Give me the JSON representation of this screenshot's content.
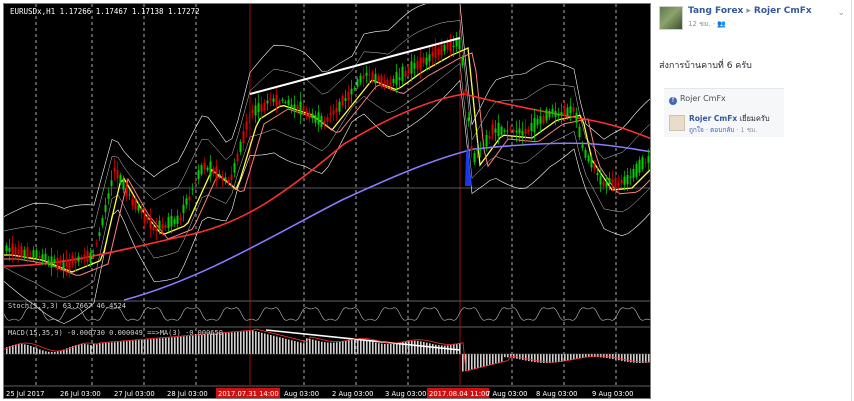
{
  "chart": {
    "symbol_info": "EURUSDx,H1  1.17266 1.17467 1.17138 1.17272",
    "stoch_label": "Stoch(5,3,3) 63.7667 46.4524",
    "macd_label": "MACD(15,35,9) -0.000730 0.000049 ==>MA(3) -0.000650",
    "x_labels": [
      "25 Jul 2017",
      "26 Jul 03:00",
      "27 Jul 03:00",
      "28 Jul 03:00",
      "2017.07.31 14:00",
      "Aug 03:00",
      "2 Aug 03:00",
      "3 Aug 03:00",
      "2017.08.04 11:00",
      "7 Aug 03:00",
      "8 Aug 03:00",
      "9 Aug 03:00"
    ],
    "colors": {
      "background": "#000000",
      "bull_candle": "#00d000",
      "bear_candle": "#e00000",
      "bollinger": "#ffffff",
      "ma_fast": "#ffff40",
      "ma_mid": "#ff8080",
      "ma_slow": "#ff3030",
      "ma_long": "#8a7bff",
      "vline_marker": "#c01010",
      "macd_hist": "#d0d0d0",
      "trend_line": "#ffffff"
    }
  },
  "post": {
    "author": "Tang Forex",
    "separator": "▸",
    "page": "Rojer CmFx",
    "meta": "12 ชม. · 👥",
    "text": "ส่งการบ้านคาบที่ 6 ครับ",
    "chevron": "⌄"
  },
  "comment": {
    "page_label": "Rojer CmFx",
    "fb_icon": "f",
    "commenter": "Rojer CmFx",
    "text": " เยี่ยมครับ",
    "like": "ถูกใจ",
    "dot": " · ",
    "reply": "ตอบกลับ",
    "time": " · 1 ชม."
  }
}
